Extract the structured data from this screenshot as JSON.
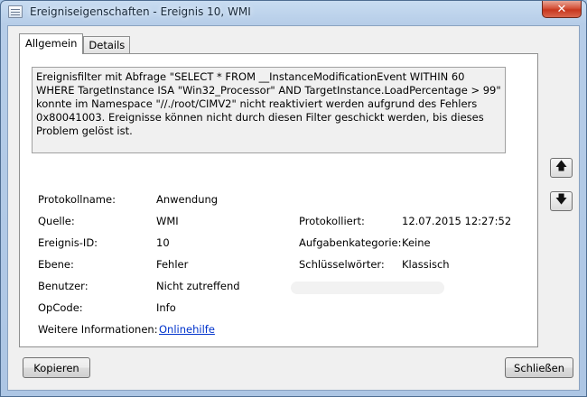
{
  "window": {
    "title": "Ereigniseigenschaften - Ereignis 10, WMI",
    "close_glyph": "✕"
  },
  "tabs": [
    {
      "label": "Allgemein",
      "active": true
    },
    {
      "label": "Details",
      "active": false
    }
  ],
  "description": "Ereignisfilter mit Abfrage \"SELECT * FROM __InstanceModificationEvent WITHIN 60 WHERE TargetInstance ISA \"Win32_Processor\" AND TargetInstance.LoadPercentage > 99\" konnte im Namespace \"//./root/CIMV2\" nicht reaktiviert werden aufgrund des Fehlers 0x80041003. Ereignisse können nicht durch diesen Filter geschickt werden, bis dieses Problem gelöst ist.",
  "fields": {
    "protokollname_label": "Protokollname:",
    "protokollname_value": "Anwendung",
    "quelle_label": "Quelle:",
    "quelle_value": "WMI",
    "ereignis_id_label": "Ereignis-ID:",
    "ereignis_id_value": "10",
    "ebene_label": "Ebene:",
    "ebene_value": "Fehler",
    "benutzer_label": "Benutzer:",
    "benutzer_value": "Nicht zutreffend",
    "opcode_label": "OpCode:",
    "opcode_value": "Info",
    "weitere_label": "Weitere Informationen:",
    "weitere_link": "Onlinehilfe",
    "protokolliert_label": "Protokolliert:",
    "protokolliert_value": "12.07.2015 12:27:52",
    "aufgabenkategorie_label": "Aufgabenkategorie:",
    "aufgabenkategorie_value": "Keine",
    "schluesselwoerter_label": "Schlüsselwörter:",
    "schluesselwoerter_value": "Klassisch"
  },
  "nav": {
    "up_glyph": "🡅",
    "down_glyph": "🡇"
  },
  "buttons": {
    "copy": "Kopieren",
    "close": "Schließen"
  },
  "icons": {
    "title": "event-properties-icon",
    "up": "arrow-up-icon",
    "down": "arrow-down-icon"
  },
  "colors": {
    "link": "#0033cc",
    "close_button": "#c7371e"
  }
}
